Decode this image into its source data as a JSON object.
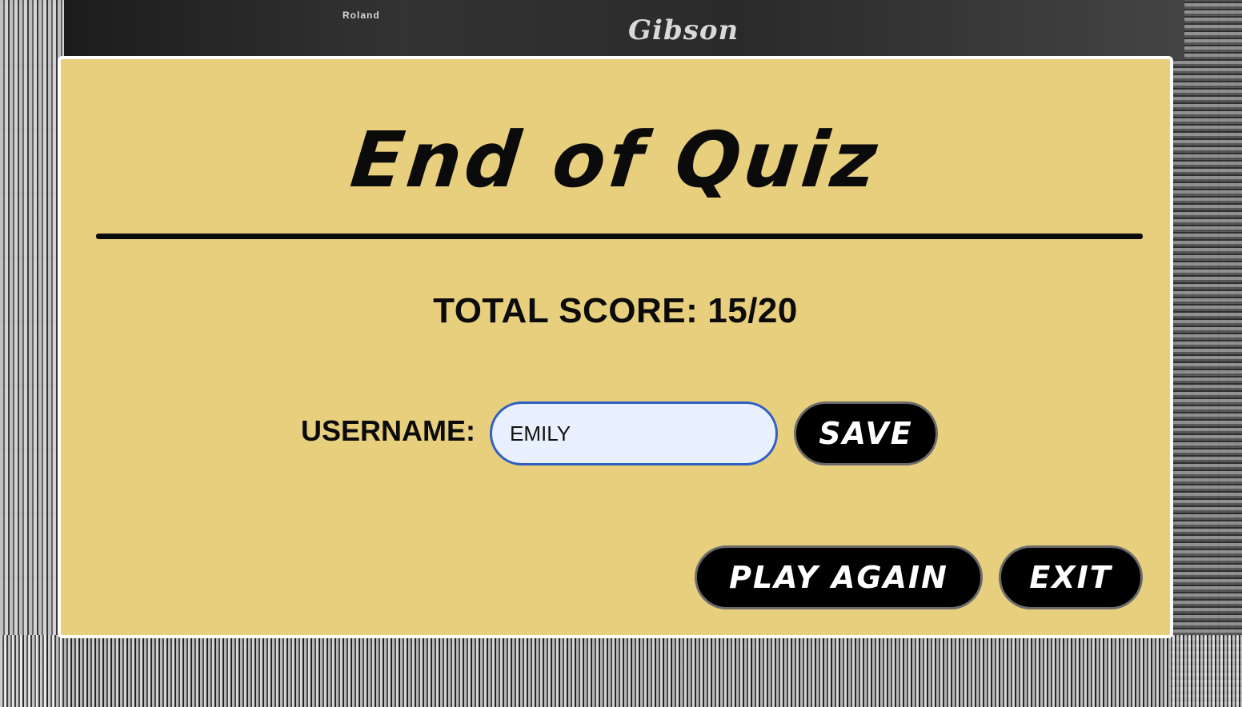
{
  "background": {
    "amp_brand_left": "Roland",
    "amp_brand_center": "Gibson"
  },
  "panel": {
    "title": "End of Quiz",
    "score_label": "TOTAL SCORE:",
    "score_value": "15/20",
    "username_label": "USERNAME:",
    "username_value": "EMILY",
    "save_label": "SAVE",
    "play_again_label": "PLAY AGAIN",
    "exit_label": "EXIT"
  },
  "colors": {
    "panel_background": "#e8cf7d",
    "button_background": "#000000",
    "input_focus_border": "#2f5fc4",
    "input_background": "#e8f0fe"
  }
}
